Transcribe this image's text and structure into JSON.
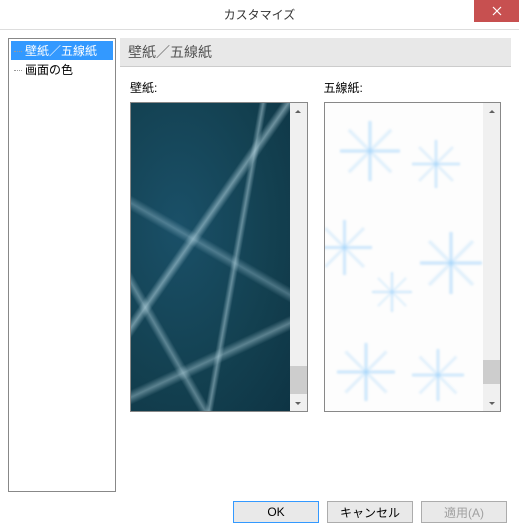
{
  "window": {
    "title": "カスタマイズ"
  },
  "tree": {
    "items": [
      {
        "label": "壁紙／五線紙",
        "selected": true
      },
      {
        "label": "画面の色",
        "selected": false
      }
    ]
  },
  "panel": {
    "header": "壁紙／五線紙",
    "wallpaper_label": "壁紙:",
    "staff_label": "五線紙:"
  },
  "buttons": {
    "ok": "OK",
    "cancel": "キャンセル",
    "apply": "適用(A)"
  }
}
